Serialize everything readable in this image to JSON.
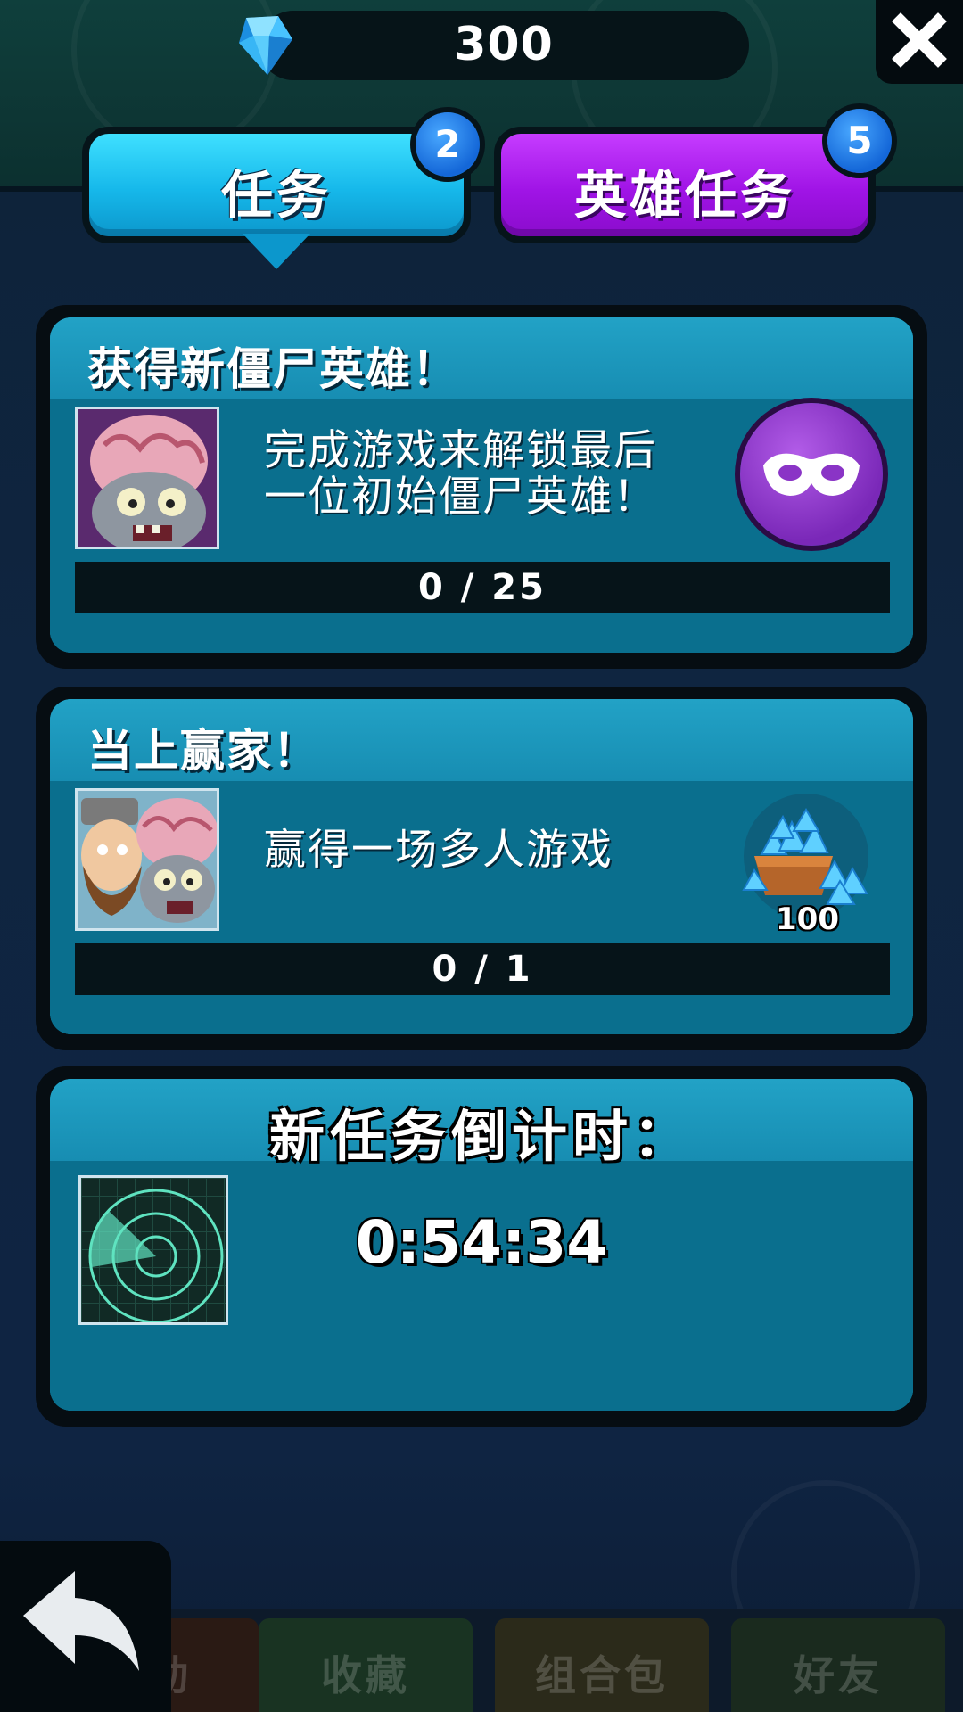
{
  "currency": {
    "gems": "300",
    "icon": "gem-icon"
  },
  "tabs": [
    {
      "label": "任务",
      "badge": "2",
      "color": "#16b8ea",
      "active": true
    },
    {
      "label": "英雄任务",
      "badge": "5",
      "color": "#a014e6",
      "active": false
    }
  ],
  "quests": [
    {
      "title": "获得新僵尸英雄！",
      "description_line1": "完成游戏来解锁最后",
      "description_line2": "一位初始僵尸英雄！",
      "progress_text": "0 / 25",
      "progress": 0,
      "reward_icon": "mask-icon"
    },
    {
      "title": "当上赢家！",
      "description_line1": "赢得一场多人游戏",
      "progress_text": "0 / 1",
      "progress": 0,
      "reward_icon": "gem-pile-icon",
      "reward_amount": "100"
    }
  ],
  "countdown": {
    "title": "新任务倒计时：",
    "time": "0:54:34",
    "icon": "radar-icon"
  },
  "bottom_nav": [
    {
      "label": "活动"
    },
    {
      "label": "收藏"
    },
    {
      "label": "组合包"
    },
    {
      "label": "好友"
    }
  ],
  "colors": {
    "accent_cyan": "#16b8ea",
    "accent_purple": "#a014e6",
    "card_fill": "#0a6f8e",
    "progress_bg": "#061419"
  }
}
